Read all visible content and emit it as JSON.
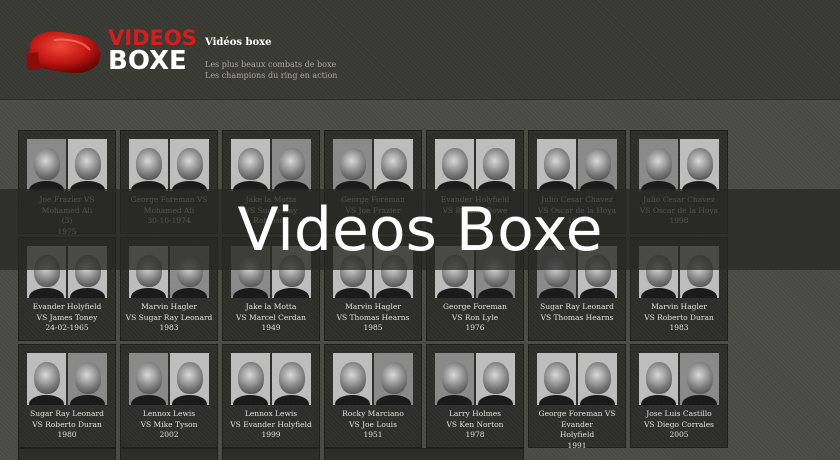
{
  "header": {
    "logo": {
      "word1": "VIDEOS",
      "word2": "BOXE"
    },
    "site_title": "Vidéos boxe",
    "tagline_1": "Les plus beaux combats de boxe",
    "tagline_2": "Les champions du ring en action"
  },
  "overlay_title": "Videos Boxe",
  "cards": [
    {
      "lines": [
        "Joe Frazier VS Mohamed Ali",
        "(3)",
        "1975"
      ]
    },
    {
      "lines": [
        "George Foreman VS",
        "Mohamed Ali",
        "30-10-1974"
      ]
    },
    {
      "lines": [
        "Jake la Motta",
        "VS Sugar Ray Robinson",
        ""
      ]
    },
    {
      "lines": [
        "George Foreman",
        "VS Joe Frazier",
        ""
      ]
    },
    {
      "lines": [
        "Evander Holyfield",
        "VS Riddick Bowe",
        ""
      ]
    },
    {
      "lines": [
        "Julio Cesar Chavez",
        "VS Oscar de la Hoya",
        "1996"
      ]
    },
    {
      "lines": [
        "Julio Cesar Chavez",
        "VS Oscar de la Hoya",
        "1998"
      ]
    },
    {
      "lines": [
        "Evander Holyfield",
        "VS James Toney",
        "24-02-1965"
      ]
    },
    {
      "lines": [
        "Marvin Hagler",
        "VS Sugar Ray Leonard",
        "1983"
      ]
    },
    {
      "lines": [
        "Jake la Motta",
        "VS Marcel Cerdan",
        "1949"
      ]
    },
    {
      "lines": [
        "Marvin Hagler",
        "VS Thomas Hearns",
        "1985"
      ]
    },
    {
      "lines": [
        "George Foreman",
        "VS Ron Lyle",
        "1976"
      ]
    },
    {
      "lines": [
        "Sugar Ray Leonard",
        "VS Thomas Hearns",
        ""
      ]
    },
    {
      "lines": [
        "Marvin Hagler",
        "VS Roberto Duran",
        "1983"
      ]
    },
    {
      "lines": [
        "Sugar Ray Leonard",
        "VS Roberto Duran",
        "1980"
      ]
    },
    {
      "lines": [
        "Lennox Lewis",
        "VS Mike Tyson",
        "2002"
      ]
    },
    {
      "lines": [
        "Lennox Lewis",
        "VS Evander Holyfield",
        "1999"
      ]
    },
    {
      "lines": [
        "Rocky Marciano",
        "VS Joe Louis",
        "1951"
      ]
    },
    {
      "lines": [
        "Larry Holmes",
        "VS Ken Norton",
        "1978"
      ]
    },
    {
      "lines": [
        "George Foreman VS Evander",
        "Holyfield",
        "1991"
      ]
    },
    {
      "lines": [
        "Jose Luis Castillo",
        "VS Diego Corrales",
        "2005"
      ]
    }
  ]
}
